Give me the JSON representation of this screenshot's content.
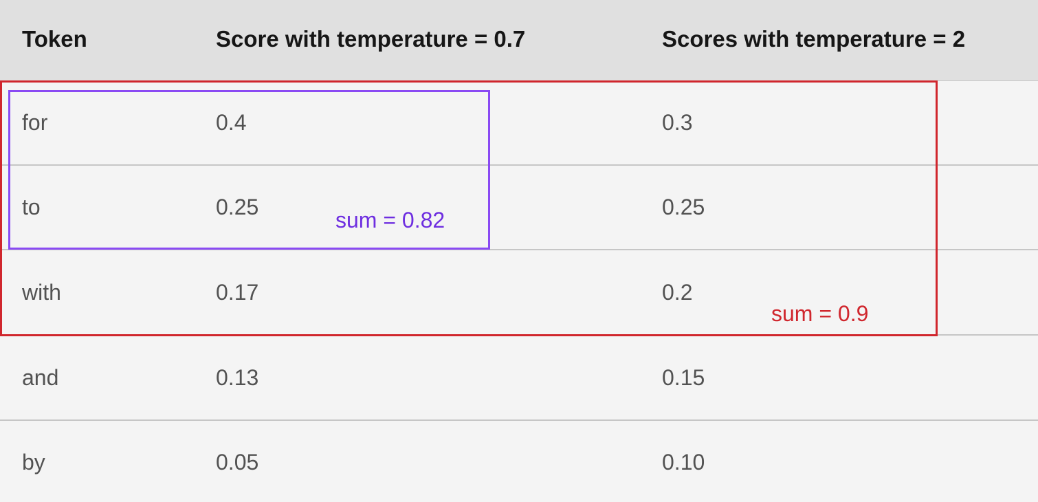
{
  "table": {
    "headers": [
      "Token",
      "Score with temperature = 0.7",
      "Scores with temperature = 2"
    ],
    "rows": [
      {
        "token": "for",
        "score_t07": "0.4",
        "score_t2": "0.3"
      },
      {
        "token": "to",
        "score_t07": "0.25",
        "score_t2": "0.25"
      },
      {
        "token": "with",
        "score_t07": "0.17",
        "score_t2": "0.2"
      },
      {
        "token": "and",
        "score_t07": "0.13",
        "score_t2": "0.15"
      },
      {
        "token": "by",
        "score_t07": "0.05",
        "score_t2": "0.10"
      }
    ]
  },
  "annotations": {
    "purple_label": "sum = 0.82",
    "red_label": "sum = 0.9",
    "purple_color": "#8a4af3",
    "red_color": "#d0262d"
  }
}
